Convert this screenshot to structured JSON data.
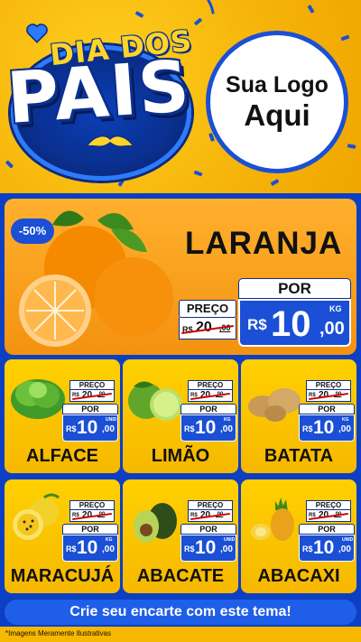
{
  "header": {
    "title_top": "DIA DOS",
    "title_main": "PAIS",
    "logo_line1": "Sua Logo",
    "logo_line2": "Aqui"
  },
  "featured": {
    "discount_badge": "-50%",
    "name": "LARANJA",
    "old_label": "PREÇO",
    "old_currency": "R$",
    "old_integer": "20",
    "old_cents": ",00",
    "new_label": "POR",
    "new_currency": "R$",
    "new_integer": "10",
    "new_cents": ",00",
    "unit": "KG"
  },
  "products": [
    {
      "name": "ALFACE",
      "old_label": "PREÇO",
      "old_currency": "R$",
      "old_integer": "20",
      "old_cents": ",00",
      "new_label": "POR",
      "new_currency": "R$",
      "new_integer": "10",
      "new_cents": ",00",
      "unit": "UNID"
    },
    {
      "name": "LIMÃO",
      "old_label": "PREÇO",
      "old_currency": "R$",
      "old_integer": "20",
      "old_cents": ",00",
      "new_label": "POR",
      "new_currency": "R$",
      "new_integer": "10",
      "new_cents": ",00",
      "unit": "KG"
    },
    {
      "name": "BATATA",
      "old_label": "PREÇO",
      "old_currency": "R$",
      "old_integer": "20",
      "old_cents": ",00",
      "new_label": "POR",
      "new_currency": "R$",
      "new_integer": "10",
      "new_cents": ",00",
      "unit": "KG"
    },
    {
      "name": "MARACUJÁ",
      "old_label": "PREÇO",
      "old_currency": "R$",
      "old_integer": "20",
      "old_cents": ",00",
      "new_label": "POR",
      "new_currency": "R$",
      "new_integer": "10",
      "new_cents": ",00",
      "unit": "KG"
    },
    {
      "name": "ABACATE",
      "old_label": "PREÇO",
      "old_currency": "R$",
      "old_integer": "20",
      "old_cents": ",00",
      "new_label": "POR",
      "new_currency": "R$",
      "new_integer": "10",
      "new_cents": ",00",
      "unit": "UNID"
    },
    {
      "name": "ABACAXI",
      "old_label": "PREÇO",
      "old_currency": "R$",
      "old_integer": "20",
      "old_cents": ",00",
      "new_label": "POR",
      "new_currency": "R$",
      "new_integer": "10",
      "new_cents": ",00",
      "unit": "UNID"
    }
  ],
  "cta_label": "Crie seu encarte com este tema!",
  "disclaimer": "*Imagens Meramente Ilustrativas",
  "icons": [
    "heart-icon",
    "mustache-icon",
    "orange-icon",
    "lettuce-icon",
    "lime-icon",
    "potato-icon",
    "passion-fruit-icon",
    "avocado-icon",
    "pineapple-icon"
  ],
  "colors": {
    "brand_blue": "#1a4fd6",
    "panel_blue": "#0d3fc2",
    "yellow": "#f6b800",
    "orange": "#f39211"
  }
}
